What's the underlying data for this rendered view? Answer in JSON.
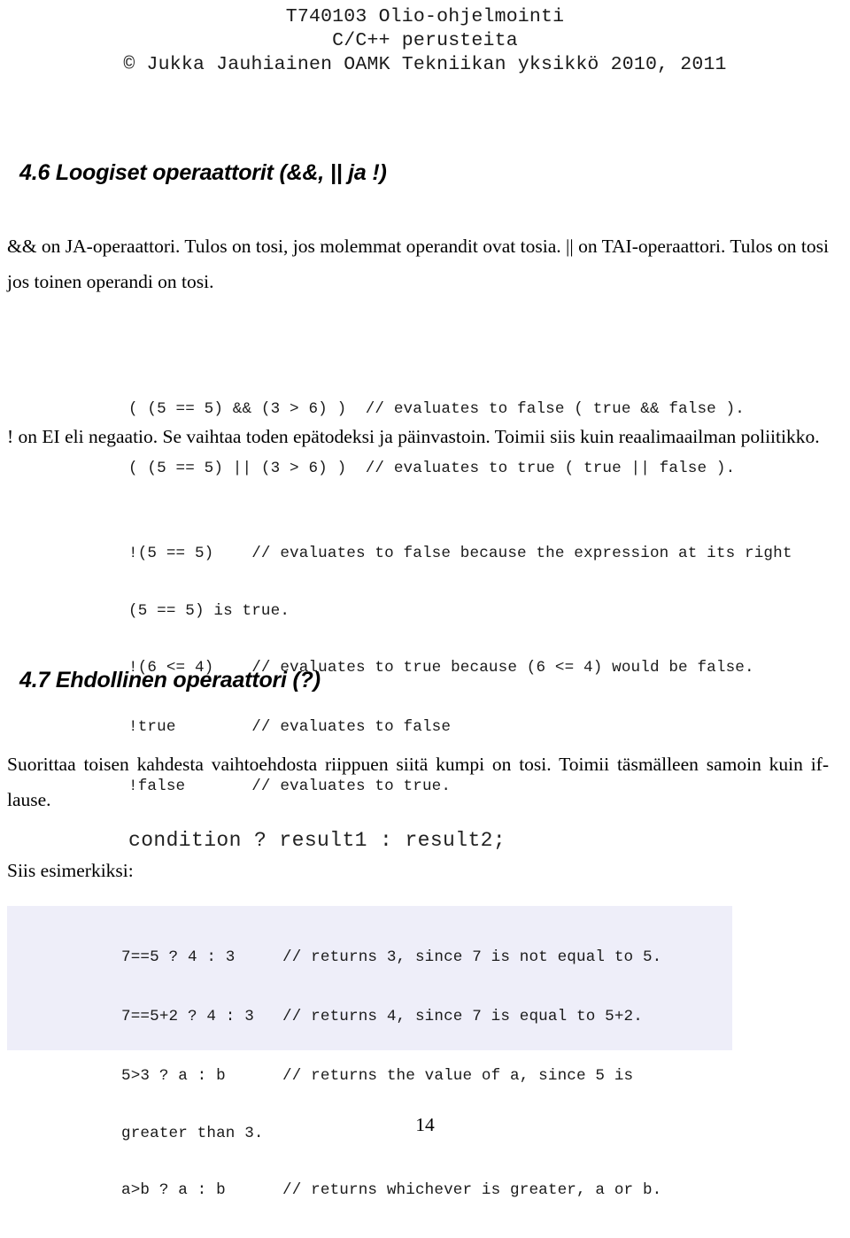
{
  "header": {
    "line1": "T740103 Olio-ohjelmointi",
    "line2": "C/C++ perusteita",
    "line3": "© Jukka Jauhiainen OAMK Tekniikan yksikkö 2010, 2011"
  },
  "sections": {
    "logical": {
      "heading": "4.6 Loogiset operaattorit (&&, || ja !)",
      "intro_paragraph": "&& on JA-operaattori. Tulos on tosi, jos molemmat operandit ovat tosia. || on TAI-operaattori. Tulos on tosi jos toinen operandi on tosi.",
      "code_logical": [
        "( (5 == 5) && (3 > 6) )  // evaluates to false ( true && false ).",
        "( (5 == 5) || (3 > 6) )  // evaluates to true ( true || false )."
      ],
      "negation_paragraph": "! on EI eli negaatio. Se vaihtaa toden epätodeksi ja päinvastoin. Toimii siis kuin reaalimaailman poliitikko.",
      "code_negation": [
        {
          "text": "!(5 == 5)    // evaluates to false because the expression at its right",
          "continuation": false
        },
        {
          "text": "(5 == 5) is true.",
          "continuation": true
        },
        {
          "text": "!(6 <= 4)    // evaluates to true because (6 <= 4) would be false.",
          "continuation": false
        },
        {
          "text": "!true        // evaluates to false",
          "continuation": false
        },
        {
          "text": "!false       // evaluates to true.",
          "continuation": false
        }
      ]
    },
    "ternary": {
      "heading": "4.7 Ehdollinen operaattori (?)",
      "intro_paragraph": "Suorittaa toisen kahdesta vaihtoehdosta riippuen siitä kumpi on tosi. Toimii täsmälleen samoin kuin if-lause.",
      "form": "condition ? result1 : result2;",
      "examples_label": "Siis esimerkiksi:",
      "panel_background": "#eeeef9",
      "code_examples": [
        {
          "text": "7==5 ? 4 : 3     // returns 3, since 7 is not equal to 5.",
          "continuation": false
        },
        {
          "text": "7==5+2 ? 4 : 3   // returns 4, since 7 is equal to 5+2.",
          "continuation": false
        },
        {
          "text": "5>3 ? a : b      // returns the value of a, since 5 is",
          "continuation": false
        },
        {
          "text": "greater than 3.",
          "continuation": true
        },
        {
          "text": "a>b ? a : b      // returns whichever is greater, a or b.",
          "continuation": false
        }
      ]
    }
  },
  "footer": {
    "page_number": "14"
  }
}
